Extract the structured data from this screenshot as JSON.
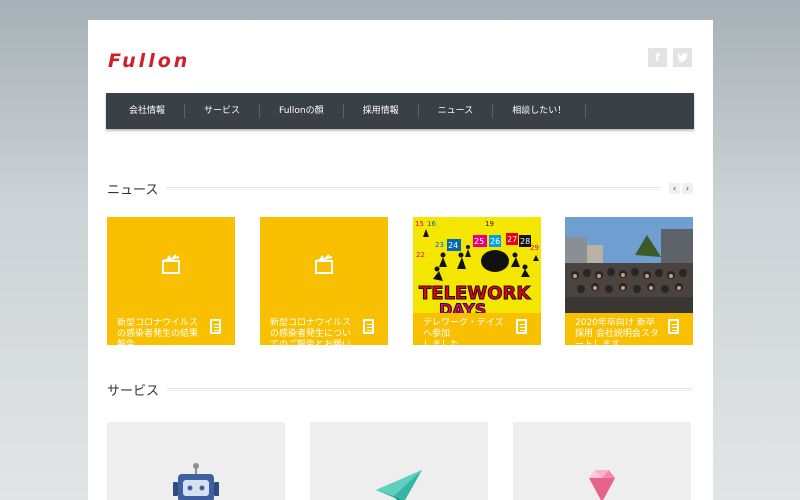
{
  "brand": {
    "logo_text": "Fullon",
    "accent": "#d01f2a"
  },
  "social": {
    "facebook": "f",
    "twitter": "t"
  },
  "nav": {
    "items": [
      {
        "label": "会社情報"
      },
      {
        "label": "サービス"
      },
      {
        "label": "Fullonの顔"
      },
      {
        "label": "採用情報"
      },
      {
        "label": "ニュース"
      },
      {
        "label": "相談したい！"
      }
    ]
  },
  "news": {
    "title": "ニュース",
    "prev": "‹",
    "next": "›",
    "cards": [
      {
        "caption": "新型コロナウイルスの感染者発生の結果報告"
      },
      {
        "caption": "新型コロナウイルスの感染者発生についてのご報告とお願い"
      },
      {
        "caption": "テレワーク・デイズへ参加\nしました"
      },
      {
        "caption": "2020年卒向け 新卒採用 会社説明会スタートします"
      }
    ]
  },
  "services": {
    "title": "サービス",
    "cards": [
      {
        "icon": "robot-icon"
      },
      {
        "icon": "paper-plane-icon"
      },
      {
        "icon": "diamond-icon"
      }
    ]
  },
  "colors": {
    "card_yellow": "#f8c000",
    "nav_bg": "#3a4146",
    "service_bg": "#eeeeee"
  }
}
